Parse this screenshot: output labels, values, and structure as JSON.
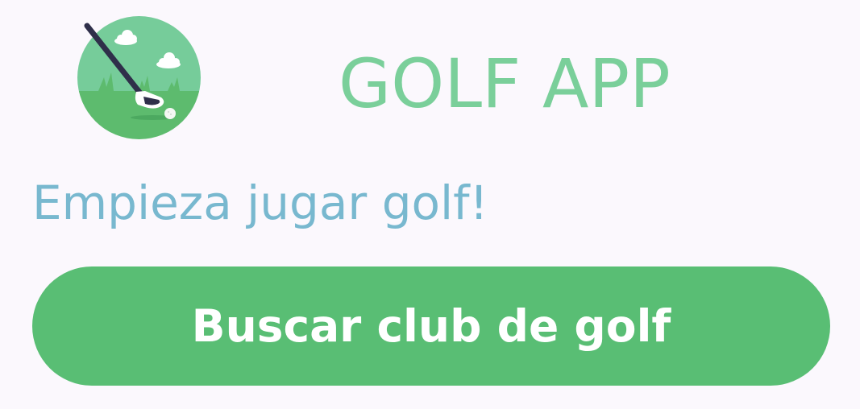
{
  "header": {
    "title": "GOLF APP",
    "logo_icon": "golf-club-logo-icon"
  },
  "main": {
    "tagline": "Empieza jugar golf!",
    "search_button_label": "Buscar club de golf"
  },
  "colors": {
    "background": "#FBF8FD",
    "title": "#7ACF9A",
    "tagline": "#78B8CF",
    "button": "#59BE74",
    "button_text": "#FFFFFF",
    "logo_sky": "#76CC9A",
    "logo_grass": "#5DBB6E",
    "logo_club": "#2F2F4A"
  }
}
